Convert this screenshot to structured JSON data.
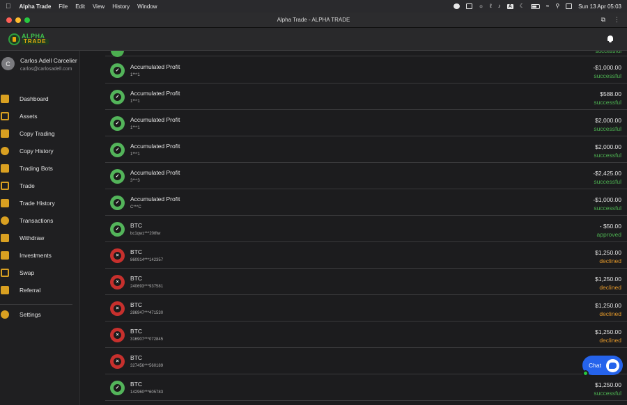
{
  "menubar": {
    "app": "Alpha Trade",
    "items": [
      "File",
      "Edit",
      "View",
      "History",
      "Window"
    ],
    "clock": "Sun 13 Apr  05:03",
    "status_icons": [
      "record-icon",
      "display-icon",
      "brightness-icon",
      "paperclip-icon",
      "sound-icon",
      "input-source-icon",
      "moon-icon",
      "battery-icon",
      "wifi-icon",
      "spotlight-icon",
      "control-center-icon"
    ],
    "input_label": "A"
  },
  "browser": {
    "title": "Alpha Trade - ALPHA TRADE"
  },
  "header": {
    "logo_line1": "ALPHA",
    "logo_line2": "TRADE"
  },
  "profile": {
    "initial": "C",
    "name": "Carlos Adell Carcelier",
    "email": "carlos@carlosadell.com"
  },
  "nav": [
    {
      "label": "Dashboard",
      "icon": "dashboard-icon"
    },
    {
      "label": "Assets",
      "icon": "wallet-icon"
    },
    {
      "label": "Copy Trading",
      "icon": "copy-trading-icon"
    },
    {
      "label": "Copy History",
      "icon": "copy-history-icon"
    },
    {
      "label": "Trading Bots",
      "icon": "robot-icon"
    },
    {
      "label": "Trade",
      "icon": "candlestick-icon"
    },
    {
      "label": "Trade History",
      "icon": "trade-history-icon"
    },
    {
      "label": "Transactions",
      "icon": "transactions-icon"
    },
    {
      "label": "Withdraw",
      "icon": "withdraw-icon"
    },
    {
      "label": "Investments",
      "icon": "investments-icon"
    },
    {
      "label": "Swap",
      "icon": "swap-icon"
    },
    {
      "label": "Referral",
      "icon": "gift-icon"
    }
  ],
  "settings_label": "Settings",
  "top_partial_status": "successful",
  "transactions": [
    {
      "title": "Accumulated Profit",
      "sub": "1***1",
      "amount": "-$1,000.00",
      "status": "successful",
      "ok": true
    },
    {
      "title": "Accumulated Profit",
      "sub": "1***1",
      "amount": "$588.00",
      "status": "successful",
      "ok": true
    },
    {
      "title": "Accumulated Profit",
      "sub": "1***1",
      "amount": "$2,000.00",
      "status": "successful",
      "ok": true
    },
    {
      "title": "Accumulated Profit",
      "sub": "1***1",
      "amount": "$2,000.00",
      "status": "successful",
      "ok": true
    },
    {
      "title": "Accumulated Profit",
      "sub": "3***3",
      "amount": "-$2,425.00",
      "status": "successful",
      "ok": true
    },
    {
      "title": "Accumulated Profit",
      "sub": "C***C",
      "amount": "-$1,000.00",
      "status": "successful",
      "ok": true
    },
    {
      "title": "BTC",
      "sub": "bc1qwz***20tftw",
      "amount": "- $50.00",
      "status": "approved",
      "ok": true
    },
    {
      "title": "BTC",
      "sub": "860914***142357",
      "amount": "$1,250.00",
      "status": "declined",
      "ok": false
    },
    {
      "title": "BTC",
      "sub": "240693***937581",
      "amount": "$1,250.00",
      "status": "declined",
      "ok": false
    },
    {
      "title": "BTC",
      "sub": "286947***471530",
      "amount": "$1,250.00",
      "status": "declined",
      "ok": false
    },
    {
      "title": "BTC",
      "sub": "316907***072845",
      "amount": "$1,250.00",
      "status": "declined",
      "ok": false
    },
    {
      "title": "BTC",
      "sub": "327456***560189",
      "amount": "",
      "status": "",
      "ok": false
    },
    {
      "title": "BTC",
      "sub": "142960***605783",
      "amount": "$1,250.00",
      "status": "successful",
      "ok": true
    }
  ],
  "chat": {
    "label": "Chat"
  },
  "colors": {
    "success": "#4caf50",
    "declined": "#e0962a",
    "error_icon": "#c7302d",
    "accent_gold": "#d9a021",
    "chat_blue": "#2563eb"
  }
}
